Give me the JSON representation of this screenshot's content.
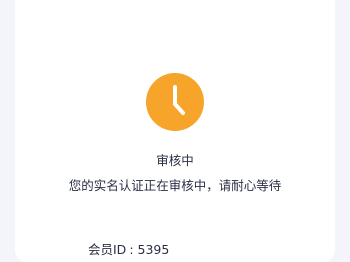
{
  "status": {
    "icon": "clock-icon",
    "icon_color": "#f7a42a",
    "title": "审核中",
    "description": "您的实名认证正在审核中，请耐心等待"
  },
  "member": {
    "label": "会员ID",
    "separator": ":",
    "value": "5395"
  }
}
